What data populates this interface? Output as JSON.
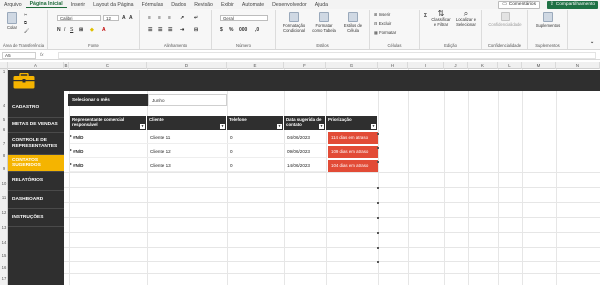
{
  "menu": [
    "Arquivo",
    "Página Inicial",
    "Inserir",
    "Layout da Página",
    "Fórmulas",
    "Dados",
    "Revisão",
    "Exibir",
    "Automate",
    "Desenvolvedor",
    "Ajuda"
  ],
  "menu_active": "Página Inicial",
  "buttons": {
    "comments": "Comentários",
    "share": "Compartilhamento"
  },
  "ribbon": {
    "paste": "Colar",
    "font_name": "Calibri",
    "font_size": "12",
    "number_format": "Geral",
    "cond_format": "Formatação Condicional",
    "format_table": "Formatar como Tabela",
    "cell_styles": "Estilos de Célula",
    "insert": "Inserir",
    "delete": "Excluir",
    "format": "Formatar",
    "sort_filter": "Classificar e Filtrar",
    "find_select": "Localizar e Selecionar",
    "confidentiality": "Confidencialidade",
    "addins": "Suplementos",
    "groups": {
      "clipboard": "Área de Transferência",
      "font": "Fonte",
      "alignment": "Alinhamento",
      "number": "Número",
      "styles": "Estilos",
      "cells": "Células",
      "editing": "Edição",
      "confidentiality": "Confidencialidade",
      "addins": "Suplementos"
    }
  },
  "formula_bar": {
    "cell": "A5",
    "fx": "fx",
    "value": ""
  },
  "columns": [
    "A",
    "B",
    "C",
    "D",
    "E",
    "F",
    "G",
    "H",
    "I",
    "J",
    "K",
    "L",
    "M",
    "N"
  ],
  "rows": [
    "1",
    "4",
    "5",
    "6",
    "7",
    "8",
    "9",
    "10",
    "11",
    "12",
    "13",
    "14",
    "15",
    "16",
    "17"
  ],
  "sidebar": [
    {
      "label": "CADASTRO",
      "active": false
    },
    {
      "label": "METAS DE VENDAS",
      "active": false
    },
    {
      "label": "CONTROLE DE REPRESENTANTES",
      "active": false
    },
    {
      "label": "CONTATOS SUGERIDOS",
      "active": true
    },
    {
      "label": "RELATÓRIOS",
      "active": false
    },
    {
      "label": "DASHBOARD",
      "active": false
    },
    {
      "label": "INSTRUÇÕES",
      "active": false
    }
  ],
  "select_month": {
    "label": "Selecionar o mês",
    "value": "Junho"
  },
  "table": {
    "headers": [
      "Representante comercial responsável",
      "Cliente",
      "Telefone",
      "Data sugerida de contato",
      "Priorização"
    ],
    "rows": [
      {
        "rep": "#N/D",
        "client": "Cliente 11",
        "phone": "0",
        "date": "04/06/2023",
        "priority": "114 dias em atraso"
      },
      {
        "rep": "#N/D",
        "client": "Cliente 12",
        "phone": "0",
        "date": "09/06/2023",
        "priority": "109 dias em atraso"
      },
      {
        "rep": "#N/D",
        "client": "Cliente 13",
        "phone": "0",
        "date": "14/06/2023",
        "priority": "104 dias em atraso"
      }
    ]
  },
  "colors": {
    "dark": "#2f2f2f",
    "accent": "#f5b400",
    "alert": "#e24b36",
    "excel_green": "#1e7145"
  }
}
